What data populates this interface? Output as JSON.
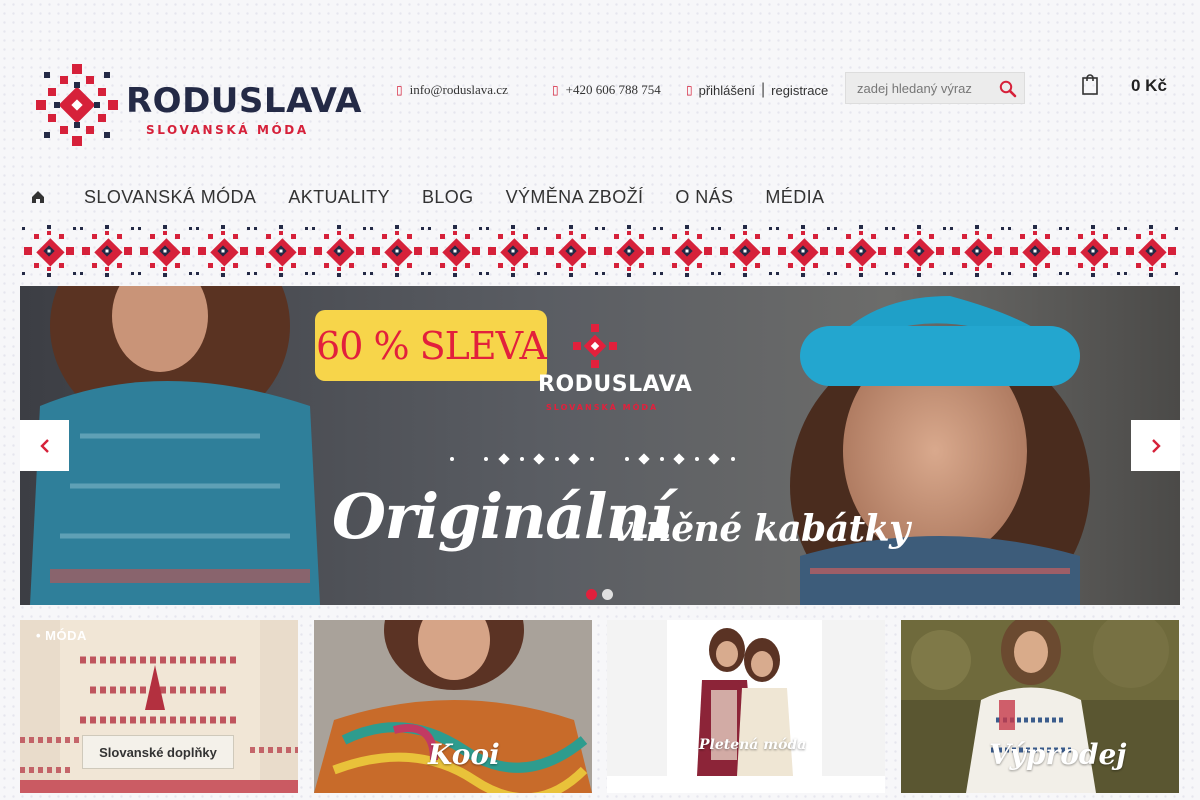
{
  "brand": {
    "name": "RODUSLAVA",
    "tagline": "SLOVANSKÁ MÓDA"
  },
  "header": {
    "email": "info@roduslava.cz",
    "phone": "+420 606 788 754",
    "login": "přihlášení",
    "separator": "|",
    "register": "registrace",
    "search_placeholder": "zadej hledaný výraz",
    "cart_total": "0 Kč"
  },
  "nav": {
    "items": [
      {
        "label": "SLOVANSKÁ MÓDA"
      },
      {
        "label": "AKTUALITY"
      },
      {
        "label": "BLOG"
      },
      {
        "label": "VÝMĚNA ZBOŽÍ"
      },
      {
        "label": "O NÁS"
      },
      {
        "label": "MÉDIA"
      }
    ]
  },
  "slider": {
    "badge": "60 % SLEVA",
    "brand": "RODUSLAVA",
    "brand_tag": "SLOVANSKÁ MÓDA",
    "headline": "Originální",
    "subline": "vlněné kabátky",
    "slide_count": 2,
    "active_slide": 1
  },
  "tiles": [
    {
      "tag": "• MÓDA",
      "label": "Slovanské doplňky"
    },
    {
      "label": "Kooi"
    },
    {
      "label": "Pletená móda"
    },
    {
      "label": "Výprodej"
    }
  ],
  "colors": {
    "brand_red": "#d6213a",
    "brand_navy": "#242a46",
    "badge_yellow": "#f7d54a"
  },
  "icons": [
    "envelope-icon",
    "phone-icon",
    "user-icon",
    "search-icon",
    "cart-icon",
    "home-icon",
    "chevron-left-icon",
    "chevron-right-icon"
  ]
}
